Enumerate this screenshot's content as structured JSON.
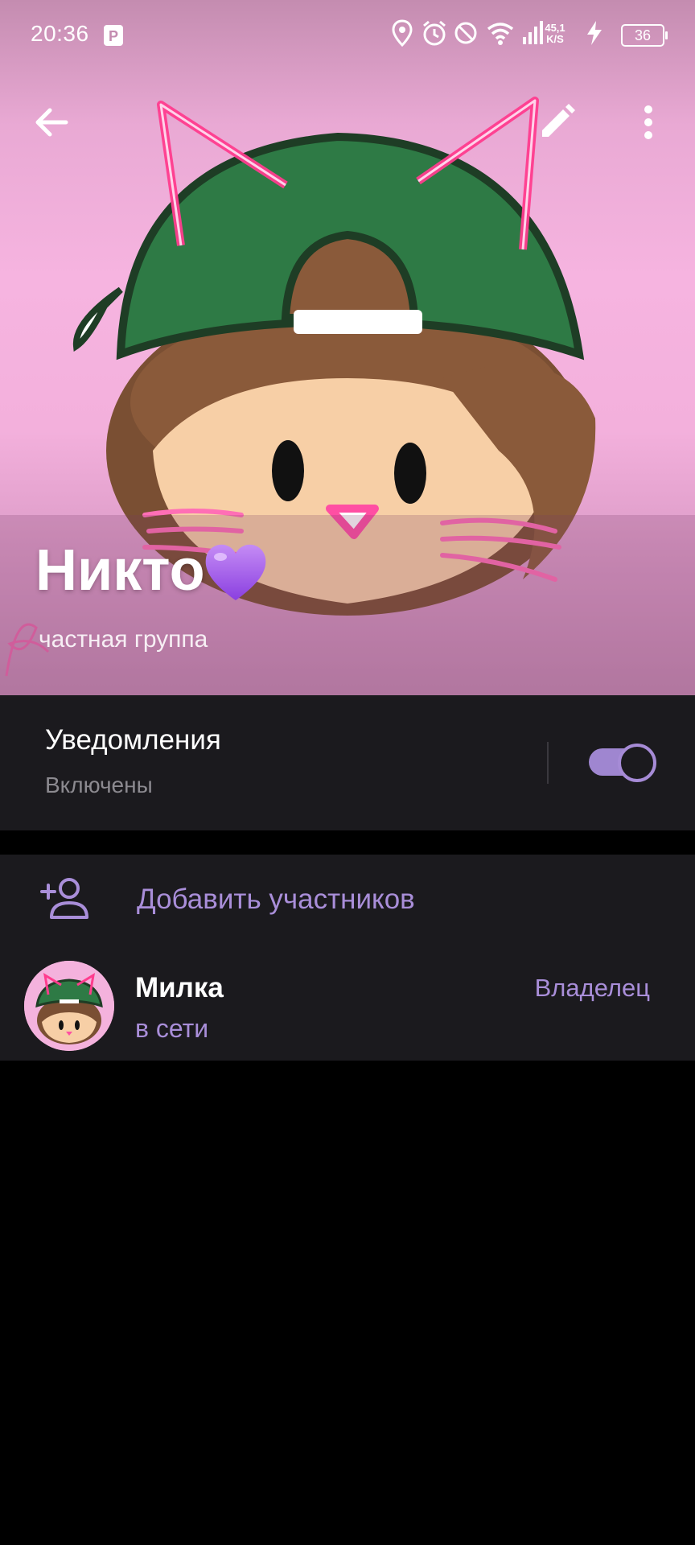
{
  "status_bar": {
    "time": "20:36",
    "net_speed_value": "45,1",
    "net_speed_unit": "K/S",
    "battery_level": "36",
    "icons": [
      "p-icon",
      "location-icon",
      "alarm-icon",
      "dnd-icon",
      "wifi-icon",
      "signal-icon",
      "charging-icon",
      "battery-icon"
    ]
  },
  "header": {
    "back_icon": "arrow-left-icon",
    "edit_icon": "pencil-icon",
    "more_icon": "more-vertical-icon",
    "title": "Никто",
    "title_emoji": "purple-heart",
    "subtitle": "частная группа"
  },
  "notifications": {
    "title": "Уведомления",
    "status": "Включены",
    "enabled": true
  },
  "members": {
    "add_label": "Добавить участников",
    "list": [
      {
        "name": "Милка",
        "status": "в сети",
        "role": "Владелец"
      }
    ]
  },
  "colors": {
    "accent": "#a98ed9",
    "panel": "#1b1a1e",
    "background": "#000000",
    "header_pink": "#f6b4e0"
  }
}
